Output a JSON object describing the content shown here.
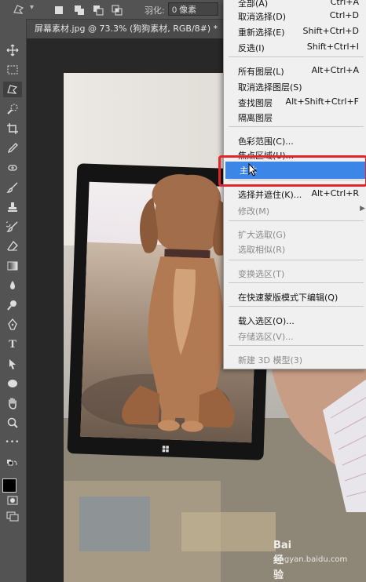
{
  "options_bar": {
    "feather_label": "羽化:",
    "feather_value": "0 像素"
  },
  "document_tab": {
    "title": "屏幕素材.jpg @ 73.3% (狗狗素材, RGB/8#) *",
    "close_glyph": "×"
  },
  "toolbar": {
    "tools": [
      "move-tool",
      "marquee-tool",
      "lasso-tool",
      "quick-select-tool",
      "crop-tool",
      "eyedropper-tool",
      "spot-heal-tool",
      "brush-tool",
      "stamp-tool",
      "history-brush-tool",
      "eraser-tool",
      "gradient-tool",
      "blur-tool",
      "dodge-tool",
      "pen-tool",
      "type-tool",
      "path-select-tool",
      "ellipse-tool",
      "hand-tool",
      "zoom-tool",
      "more-tools"
    ],
    "type_glyph": "T",
    "more_glyph": "•••"
  },
  "menu": {
    "items": [
      {
        "label": "全部(A)",
        "shortcut": "Ctrl+A",
        "state": "partial"
      },
      {
        "label": "取消选择(D)",
        "shortcut": "Ctrl+D",
        "state": "normal"
      },
      {
        "label": "重新选择(E)",
        "shortcut": "Shift+Ctrl+D",
        "state": "normal"
      },
      {
        "label": "反选(I)",
        "shortcut": "Shift+Ctrl+I",
        "state": "normal"
      },
      {
        "label": "所有图层(L)",
        "shortcut": "Alt+Ctrl+A",
        "state": "normal"
      },
      {
        "label": "取消选择图层(S)",
        "shortcut": "",
        "state": "normal"
      },
      {
        "label": "查找图层",
        "shortcut": "Alt+Shift+Ctrl+F",
        "state": "normal"
      },
      {
        "label": "隔离图层",
        "shortcut": "",
        "state": "normal"
      },
      {
        "label": "色彩范围(C)...",
        "shortcut": "",
        "state": "normal"
      },
      {
        "label": "焦点区域(U)...",
        "shortcut": "",
        "state": "partial"
      },
      {
        "label": "主体",
        "shortcut": "",
        "state": "highlight"
      },
      {
        "label": "选择并遮住(K)...",
        "shortcut": "Alt+Ctrl+R",
        "state": "partial"
      },
      {
        "label": "修改(M)",
        "shortcut": "",
        "state": "disabled"
      },
      {
        "label": "扩大选取(G)",
        "shortcut": "",
        "state": "disabled"
      },
      {
        "label": "选取相似(R)",
        "shortcut": "",
        "state": "disabled"
      },
      {
        "label": "变换选区(T)",
        "shortcut": "",
        "state": "disabled"
      },
      {
        "label": "在快速蒙版模式下编辑(Q)",
        "shortcut": "",
        "state": "normal"
      },
      {
        "label": "载入选区(O)...",
        "shortcut": "",
        "state": "normal"
      },
      {
        "label": "存储选区(V)...",
        "shortcut": "",
        "state": "disabled"
      },
      {
        "label": "新建 3D 模型(3)",
        "shortcut": "",
        "state": "disabled"
      }
    ],
    "submenu_arrow": "▶"
  },
  "watermark": {
    "text": "Bai 经验",
    "url": "jingyan.baidu.com"
  },
  "colors": {
    "highlight": "#3c86e8",
    "annotation_red": "#e3262a",
    "menu_bg": "#f0f0f0",
    "ui_dark": "#535353"
  }
}
